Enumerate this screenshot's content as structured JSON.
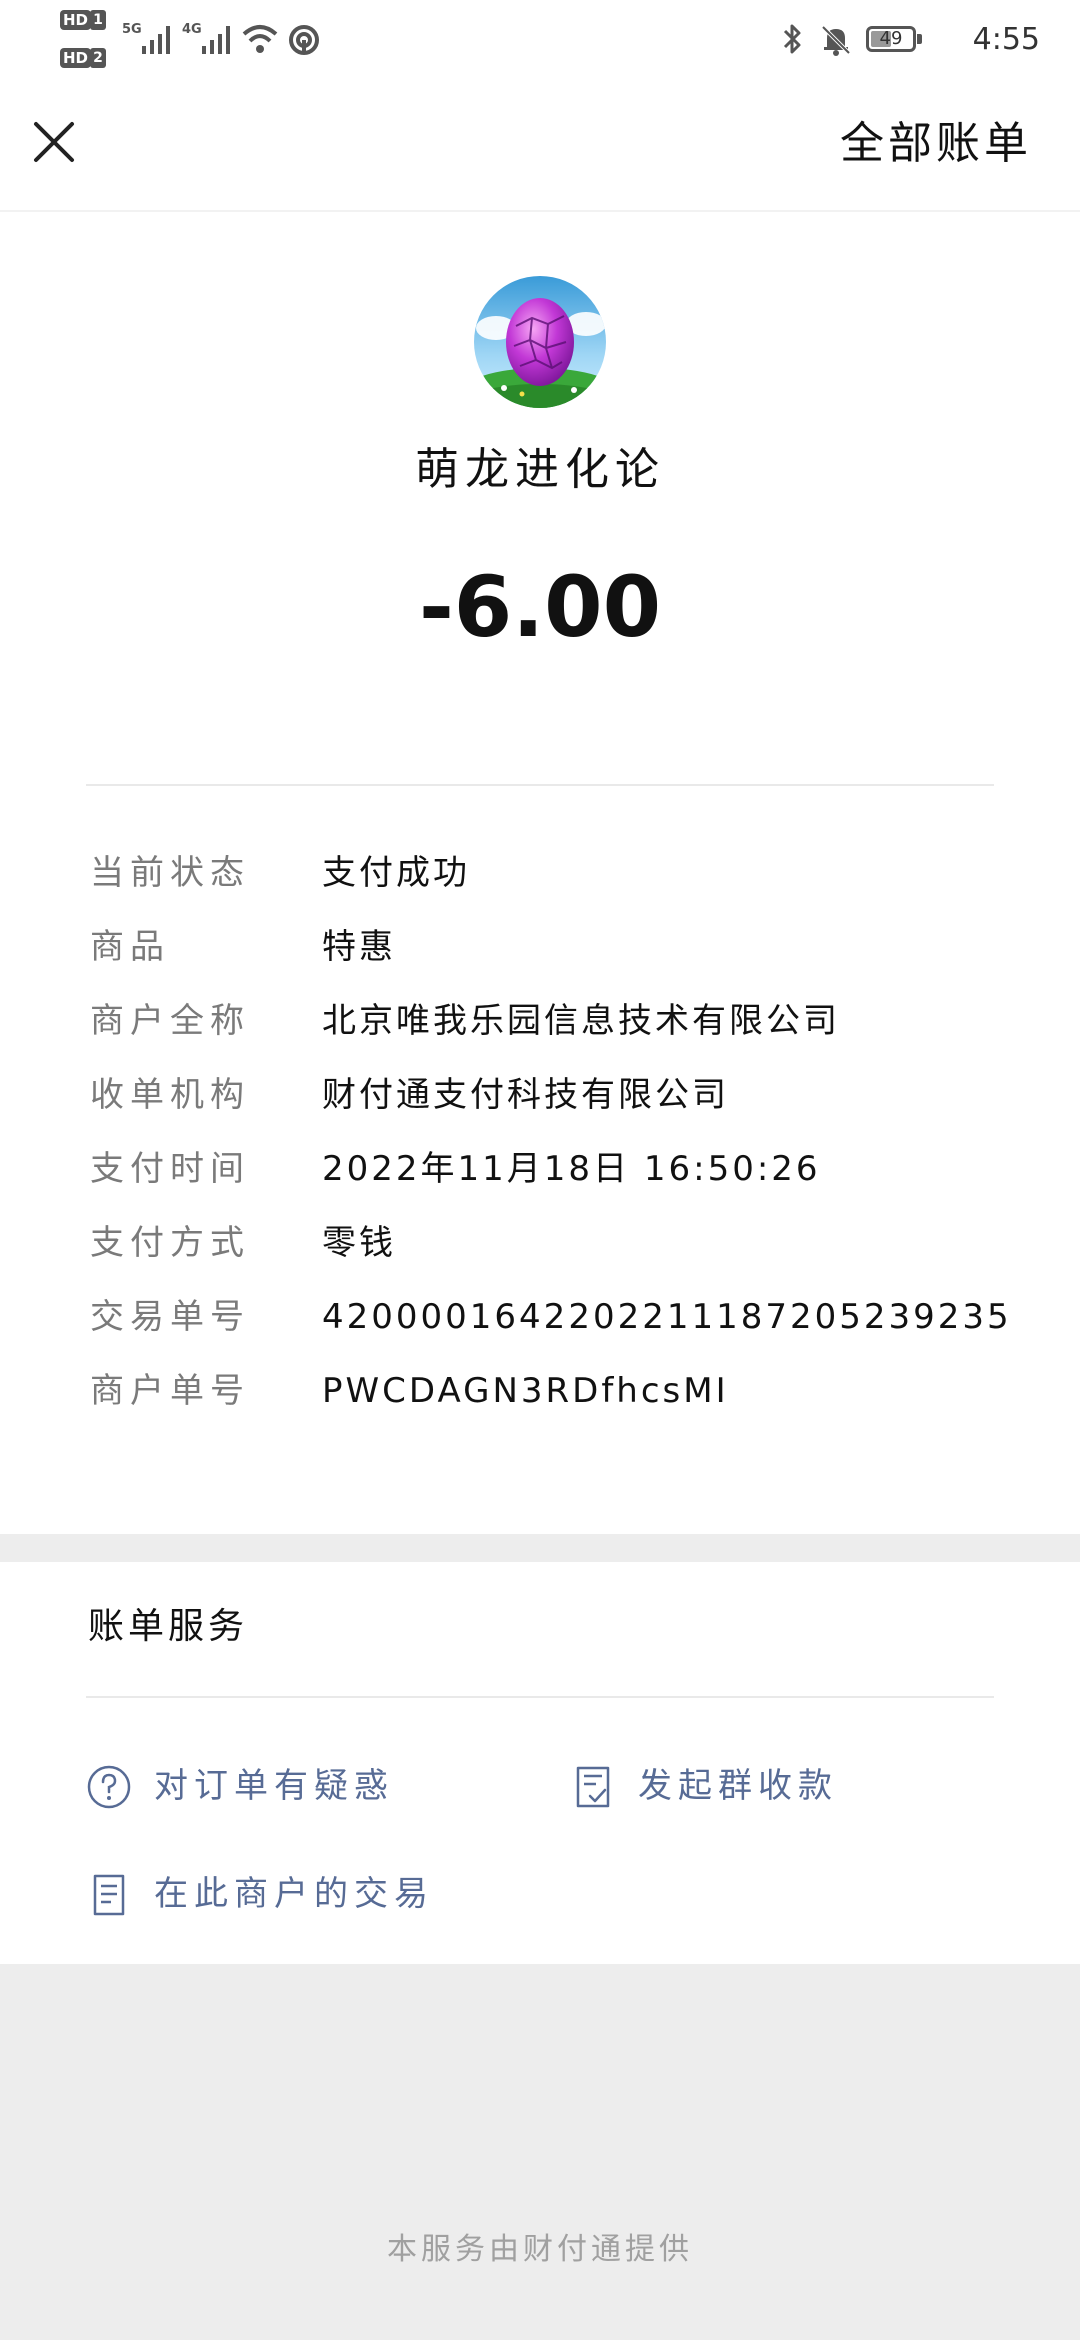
{
  "status_bar": {
    "sim1": "HD",
    "sim1_num": "1",
    "sim2": "HD",
    "sim2_num": "2",
    "net1": "5G",
    "net2": "4G",
    "battery": "49",
    "battery_percent": 49,
    "time": "4:55",
    "icons": [
      "signal-icon",
      "wifi-icon",
      "hotspot-icon",
      "bluetooth-icon",
      "mute-bell-icon",
      "battery-icon"
    ]
  },
  "header": {
    "close_icon": "close-icon",
    "all_bills": "全部账单"
  },
  "transaction": {
    "merchant_name": "萌龙进化论",
    "amount": "-6.00",
    "details": [
      {
        "label": "当前状态",
        "value": "支付成功"
      },
      {
        "label": "商品",
        "value": "特惠"
      },
      {
        "label": "商户全称",
        "value": "北京唯我乐园信息技术有限公司"
      },
      {
        "label": "收单机构",
        "value": "财付通支付科技有限公司"
      },
      {
        "label": "支付时间",
        "value": "2022年11月18日 16:50:26"
      },
      {
        "label": "支付方式",
        "value": "零钱"
      },
      {
        "label": "交易单号",
        "value": "4200001642202211187205239235"
      },
      {
        "label": "商户单号",
        "value": "PWCDAGN3RDfhcsMI"
      }
    ]
  },
  "services": {
    "title": "账单服务",
    "items": [
      {
        "label": "对订单有疑惑",
        "icon": "question-circle-icon"
      },
      {
        "label": "发起群收款",
        "icon": "checklist-icon"
      },
      {
        "label": "在此商户的交易",
        "icon": "document-icon"
      }
    ]
  },
  "footer": {
    "note": "本服务由财付通提供"
  },
  "colors": {
    "link": "#576b95",
    "label": "#7a7a7a",
    "background": "#ededed"
  }
}
